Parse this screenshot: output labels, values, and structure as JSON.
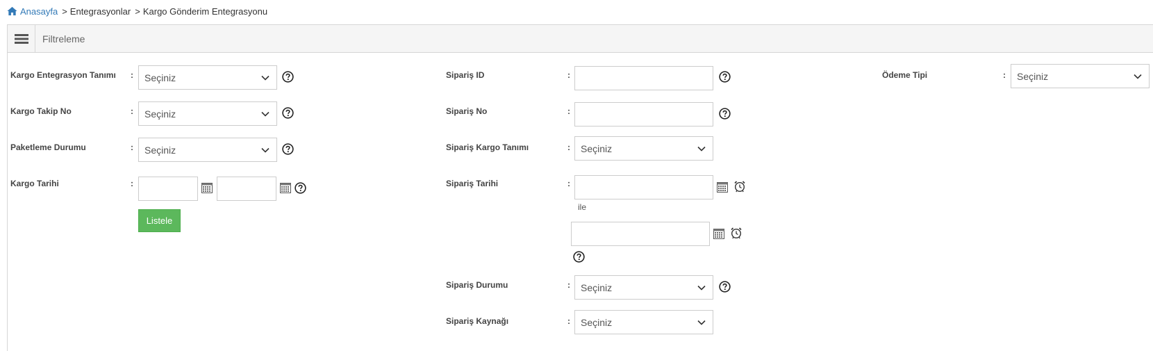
{
  "breadcrumb": {
    "home": "Anasayfa",
    "separator": ">",
    "items": [
      "Entegrasyonlar",
      "Kargo Gönderim Entegrasyonu"
    ]
  },
  "panel": {
    "title": "Filtreleme"
  },
  "colon": ":",
  "left": {
    "kargo_entegrasyon": {
      "label": "Kargo Entegrasyon Tanımı",
      "value": "Seçiniz"
    },
    "kargo_takip": {
      "label": "Kargo Takip No",
      "value": "Seçiniz"
    },
    "paketleme": {
      "label": "Paketleme Durumu",
      "value": "Seçiniz"
    },
    "kargo_tarihi": {
      "label": "Kargo Tarihi"
    },
    "list_button": "Listele"
  },
  "middle": {
    "siparis_id": {
      "label": "Sipariş ID"
    },
    "siparis_no": {
      "label": "Sipariş No"
    },
    "siparis_kargo": {
      "label": "Sipariş Kargo Tanımı",
      "value": "Seçiniz"
    },
    "siparis_tarihi": {
      "label": "Sipariş Tarihi",
      "range_word": "ile"
    },
    "siparis_durumu": {
      "label": "Sipariş Durumu",
      "value": "Seçiniz"
    },
    "siparis_kaynagi": {
      "label": "Sipariş Kaynağı",
      "value": "Seçiniz"
    }
  },
  "right": {
    "odeme_tipi": {
      "label": "Ödeme Tipi",
      "value": "Seçiniz"
    }
  },
  "colors": {
    "accent": "#337ab7",
    "button": "#5cb85c"
  }
}
